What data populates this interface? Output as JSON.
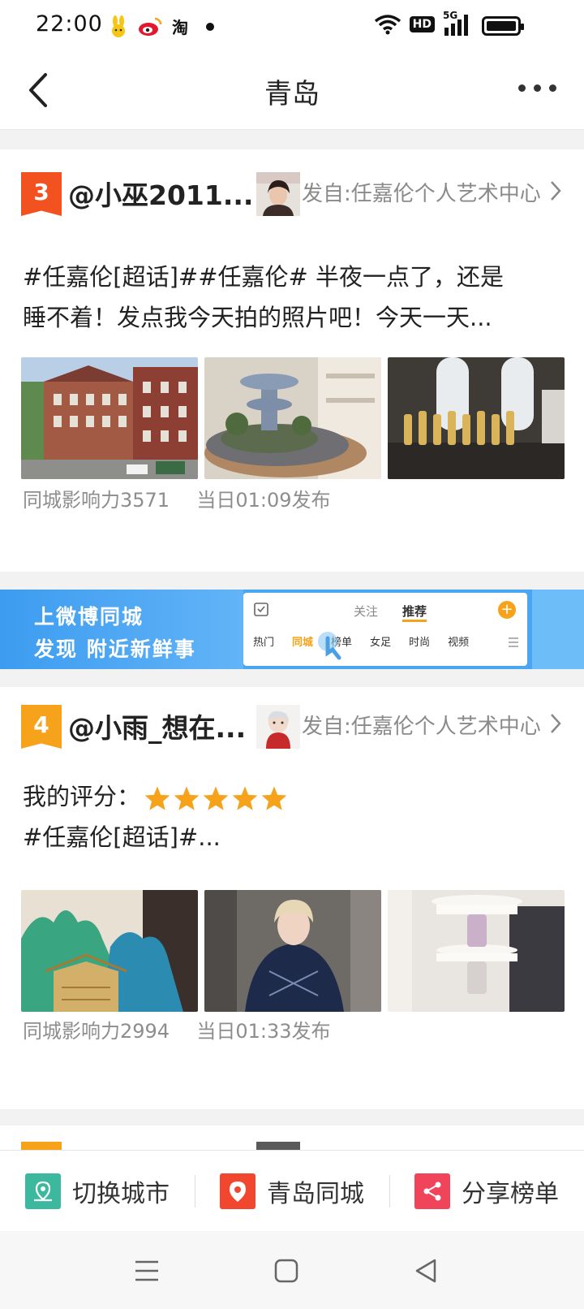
{
  "status_bar": {
    "time": "22:00",
    "notification_icons": [
      "bunny-app-icon",
      "weibo-icon",
      "taobao-icon"
    ],
    "taobao_glyph": "淘",
    "hd_badge": "HD",
    "network": "5G"
  },
  "nav": {
    "title": "青岛"
  },
  "posts": [
    {
      "rank": "3",
      "rank_color": "#f2521f",
      "user": "@小巫2011...",
      "source": "发自:任嘉伦个人艺术中心",
      "text_line1": "#任嘉伦[超话]##任嘉伦# 半夜一点了，还是",
      "text_line2": "睡不着！发点我今天拍的照片吧！今天一天...",
      "influence": "同城影响力3571",
      "time": "当日01:09发布"
    },
    {
      "rank": "4",
      "rank_color": "#f7a21b",
      "user": "@小雨_想在...",
      "source": "发自:任嘉伦个人艺术中心",
      "rating_label": "我的评分：",
      "rating": 5,
      "text_line2": "#任嘉伦[超话]#...",
      "influence": "同城影响力2994",
      "time": "当日01:33发布"
    }
  ],
  "banner": {
    "line1": "上微博同城",
    "line2": "发现 附近新鲜事",
    "tab_follow": "关注",
    "tab_recommend": "推荐",
    "categories": [
      "热门",
      "同城",
      "榜单",
      "女足",
      "时尚",
      "视频"
    ]
  },
  "bottom_bar": {
    "switch_city": "切换城市",
    "local": "青岛同城",
    "share": "分享榜单"
  },
  "colors": {
    "accent_orange": "#f7a21b",
    "rank_red": "#f2521f",
    "switch_green": "#3bb89d",
    "local_red": "#f0472e",
    "share_red": "#f0445a"
  }
}
